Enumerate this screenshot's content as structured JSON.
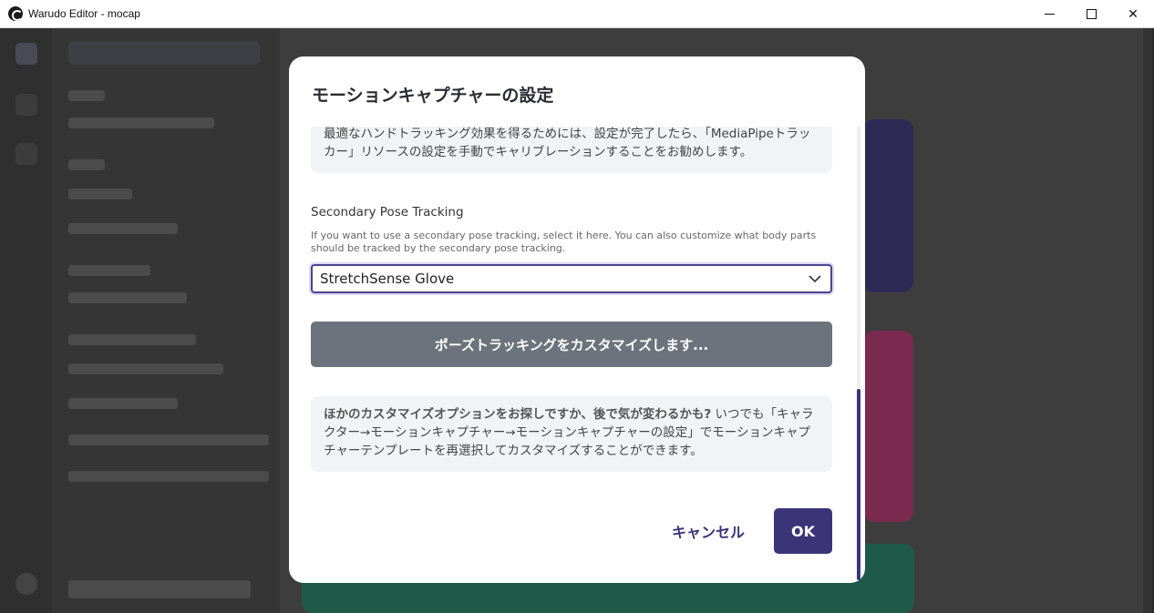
{
  "window": {
    "title": "Warudo Editor - mocap",
    "minimize_icon": "minimize-icon",
    "maximize_icon": "maximize-icon",
    "close_glyph": "✕"
  },
  "dialog": {
    "title": "モーションキャプチャーの設定",
    "hand_tracking_note": "最適なハンドトラッキング効果を得るためには、設定が完了したら、「MediaPipeトラッカー」リソースの設定を手動でキャリブレーションすることをお勧めします。",
    "secondary_pose": {
      "label": "Secondary Pose Tracking",
      "help": "If you want to use a secondary pose tracking, select it here. You can also customize what body parts should be tracked by the secondary pose tracking.",
      "selected_value": "StretchSense Glove"
    },
    "customize_button": "ポーズトラッキングをカスタマイズします...",
    "tip": {
      "bold": "ほかのカスタマイズオプションをお探しですか、後で気が変わるかも?",
      "rest": " いつでも「キャラクター→モーションキャプチャー→モーションキャプチャーの設定」でモーションキャプチャーテンプレートを再選択してカスタマイズすることができます。"
    },
    "cancel_button": "キャンセル",
    "ok_button": "OK"
  },
  "colors": {
    "accent": "#3b3578",
    "customize_button_bg": "#6c737c",
    "info_box_bg": "#f1f3f7"
  }
}
